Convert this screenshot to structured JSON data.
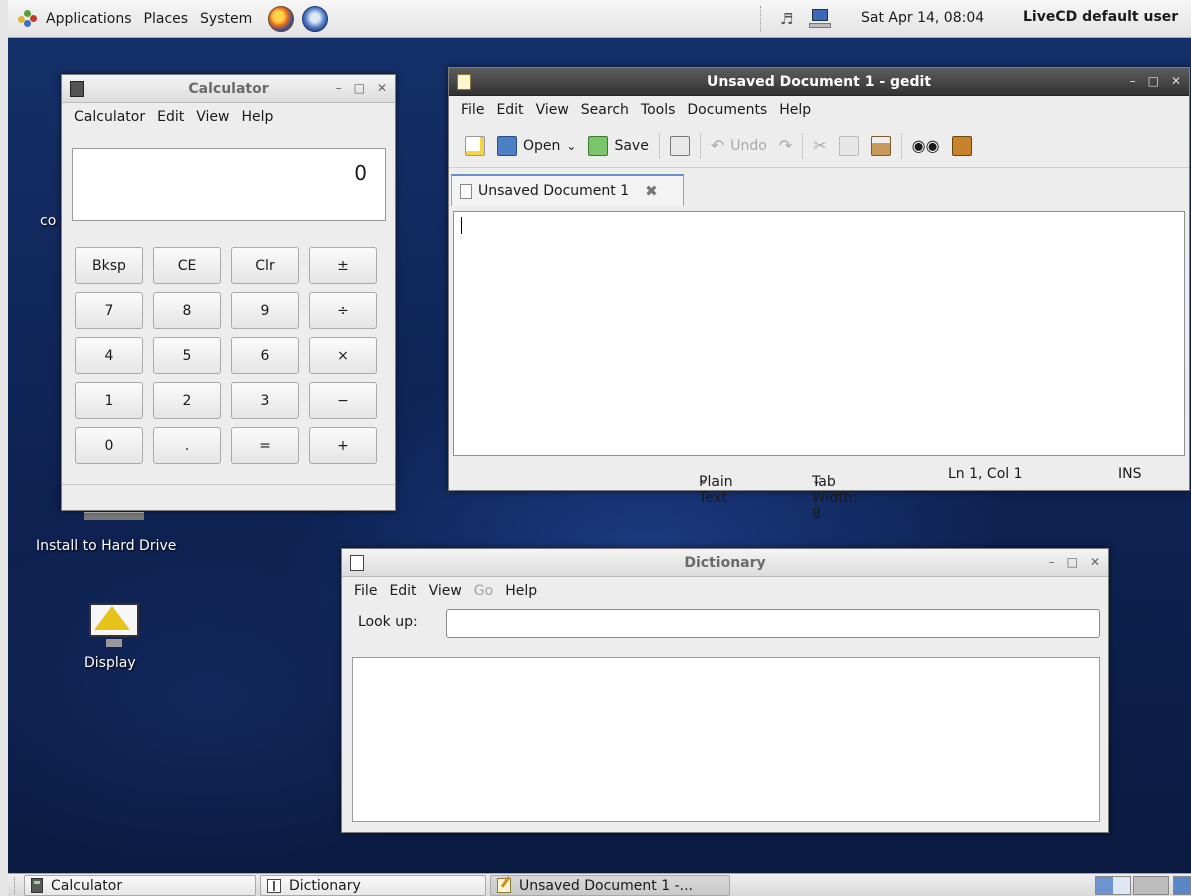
{
  "top_panel": {
    "menus": [
      "Applications",
      "Places",
      "System"
    ],
    "clock": "Sat Apr 14, 08:04",
    "user": "LiveCD default user",
    "icons": [
      "gnome-foot-icon",
      "firefox-icon",
      "thunderbird-icon",
      "volume-icon",
      "network-icon"
    ]
  },
  "desktop": {
    "icons": [
      {
        "label": "co"
      },
      {
        "label": "Install to Hard Drive"
      },
      {
        "label": "Display"
      }
    ]
  },
  "calculator": {
    "title": "Calculator",
    "menus": [
      "Calculator",
      "Edit",
      "View",
      "Help"
    ],
    "display": "0",
    "keys": [
      "Bksp",
      "CE",
      "Clr",
      "±",
      "7",
      "8",
      "9",
      "÷",
      "4",
      "5",
      "6",
      "×",
      "1",
      "2",
      "3",
      "−",
      "0",
      ".",
      "=",
      "+"
    ]
  },
  "gedit": {
    "title": "Unsaved Document 1 - gedit",
    "menus": [
      "File",
      "Edit",
      "View",
      "Search",
      "Tools",
      "Documents",
      "Help"
    ],
    "toolbar": {
      "open": "Open",
      "save": "Save",
      "undo": "Undo"
    },
    "tab": "Unsaved Document 1",
    "status": {
      "language": "Plain Text",
      "tab_width": "Tab Width: 8",
      "position": "Ln 1, Col 1",
      "mode": "INS"
    }
  },
  "dictionary": {
    "title": "Dictionary",
    "menus": [
      "File",
      "Edit",
      "View",
      "Go",
      "Help"
    ],
    "lookup_label": "Look up:",
    "lookup_value": ""
  },
  "taskbar": {
    "tasks": [
      "Calculator",
      "Dictionary",
      "Unsaved Document 1 -..."
    ]
  },
  "colors": {
    "desktop": "#0e2252",
    "active_title": "#333333",
    "tab_accent": "#6b8fc9"
  }
}
